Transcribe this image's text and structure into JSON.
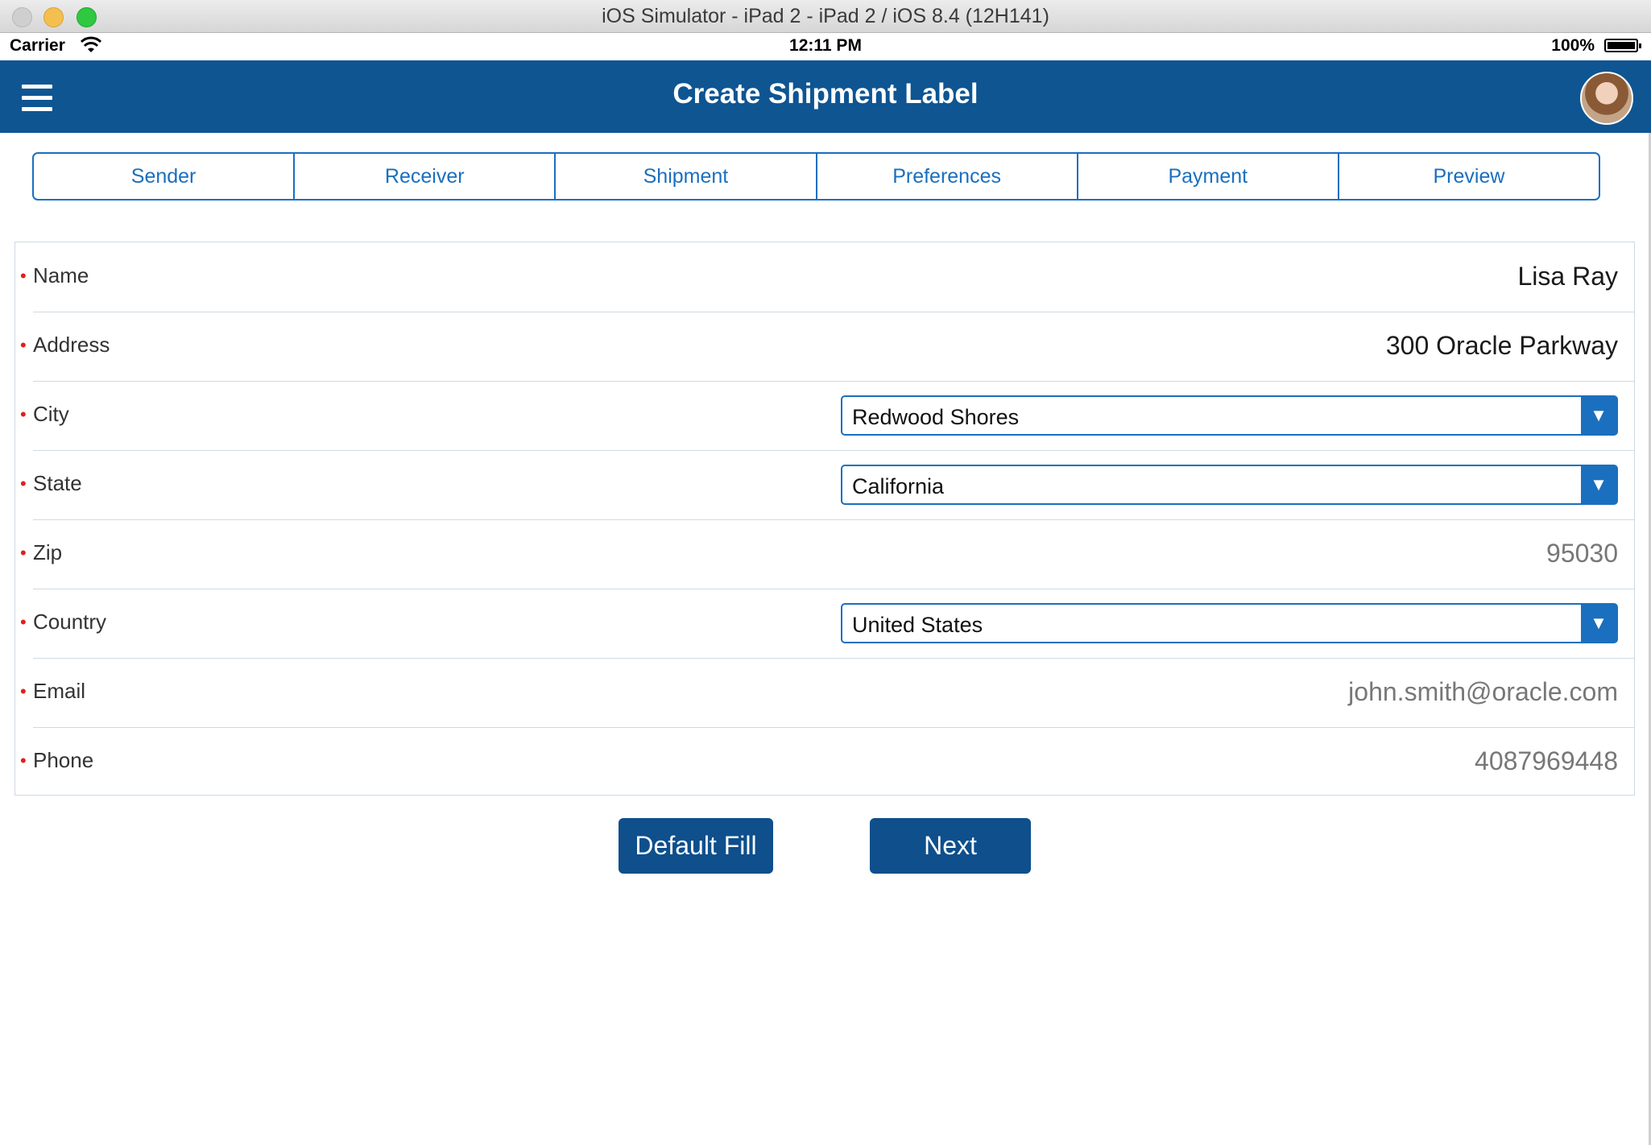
{
  "window": {
    "title": "iOS Simulator - iPad 2 - iPad 2 / iOS 8.4 (12H141)"
  },
  "status_bar": {
    "carrier": "Carrier",
    "time": "12:11 PM",
    "battery": "100%"
  },
  "header": {
    "title": "Create Shipment Label",
    "menu_icon": "hamburger-menu-icon",
    "avatar_icon": "user-avatar"
  },
  "tabs": [
    {
      "label": "Sender"
    },
    {
      "label": "Receiver"
    },
    {
      "label": "Shipment"
    },
    {
      "label": "Preferences"
    },
    {
      "label": "Payment"
    },
    {
      "label": "Preview"
    }
  ],
  "form": {
    "required_marker": "•",
    "fields": [
      {
        "label": "Name",
        "value": "Lisa Ray",
        "type": "text"
      },
      {
        "label": "Address",
        "value": "300 Oracle Parkway",
        "type": "text"
      },
      {
        "label": "City",
        "value": "Redwood Shores",
        "type": "select"
      },
      {
        "label": "State",
        "value": "California",
        "type": "select"
      },
      {
        "label": "Zip",
        "value": "95030",
        "type": "placeholder"
      },
      {
        "label": "Country",
        "value": "United States",
        "type": "select"
      },
      {
        "label": "Email",
        "value": "john.smith@oracle.com",
        "type": "placeholder"
      },
      {
        "label": "Phone",
        "value": "4087969448",
        "type": "placeholder"
      }
    ]
  },
  "buttons": {
    "default_fill": "Default Fill",
    "next": "Next"
  },
  "colors": {
    "header_bg": "#0e5592",
    "accent": "#1a6fbf",
    "button_bg": "#0e4f8c",
    "required": "#e01f1f"
  }
}
